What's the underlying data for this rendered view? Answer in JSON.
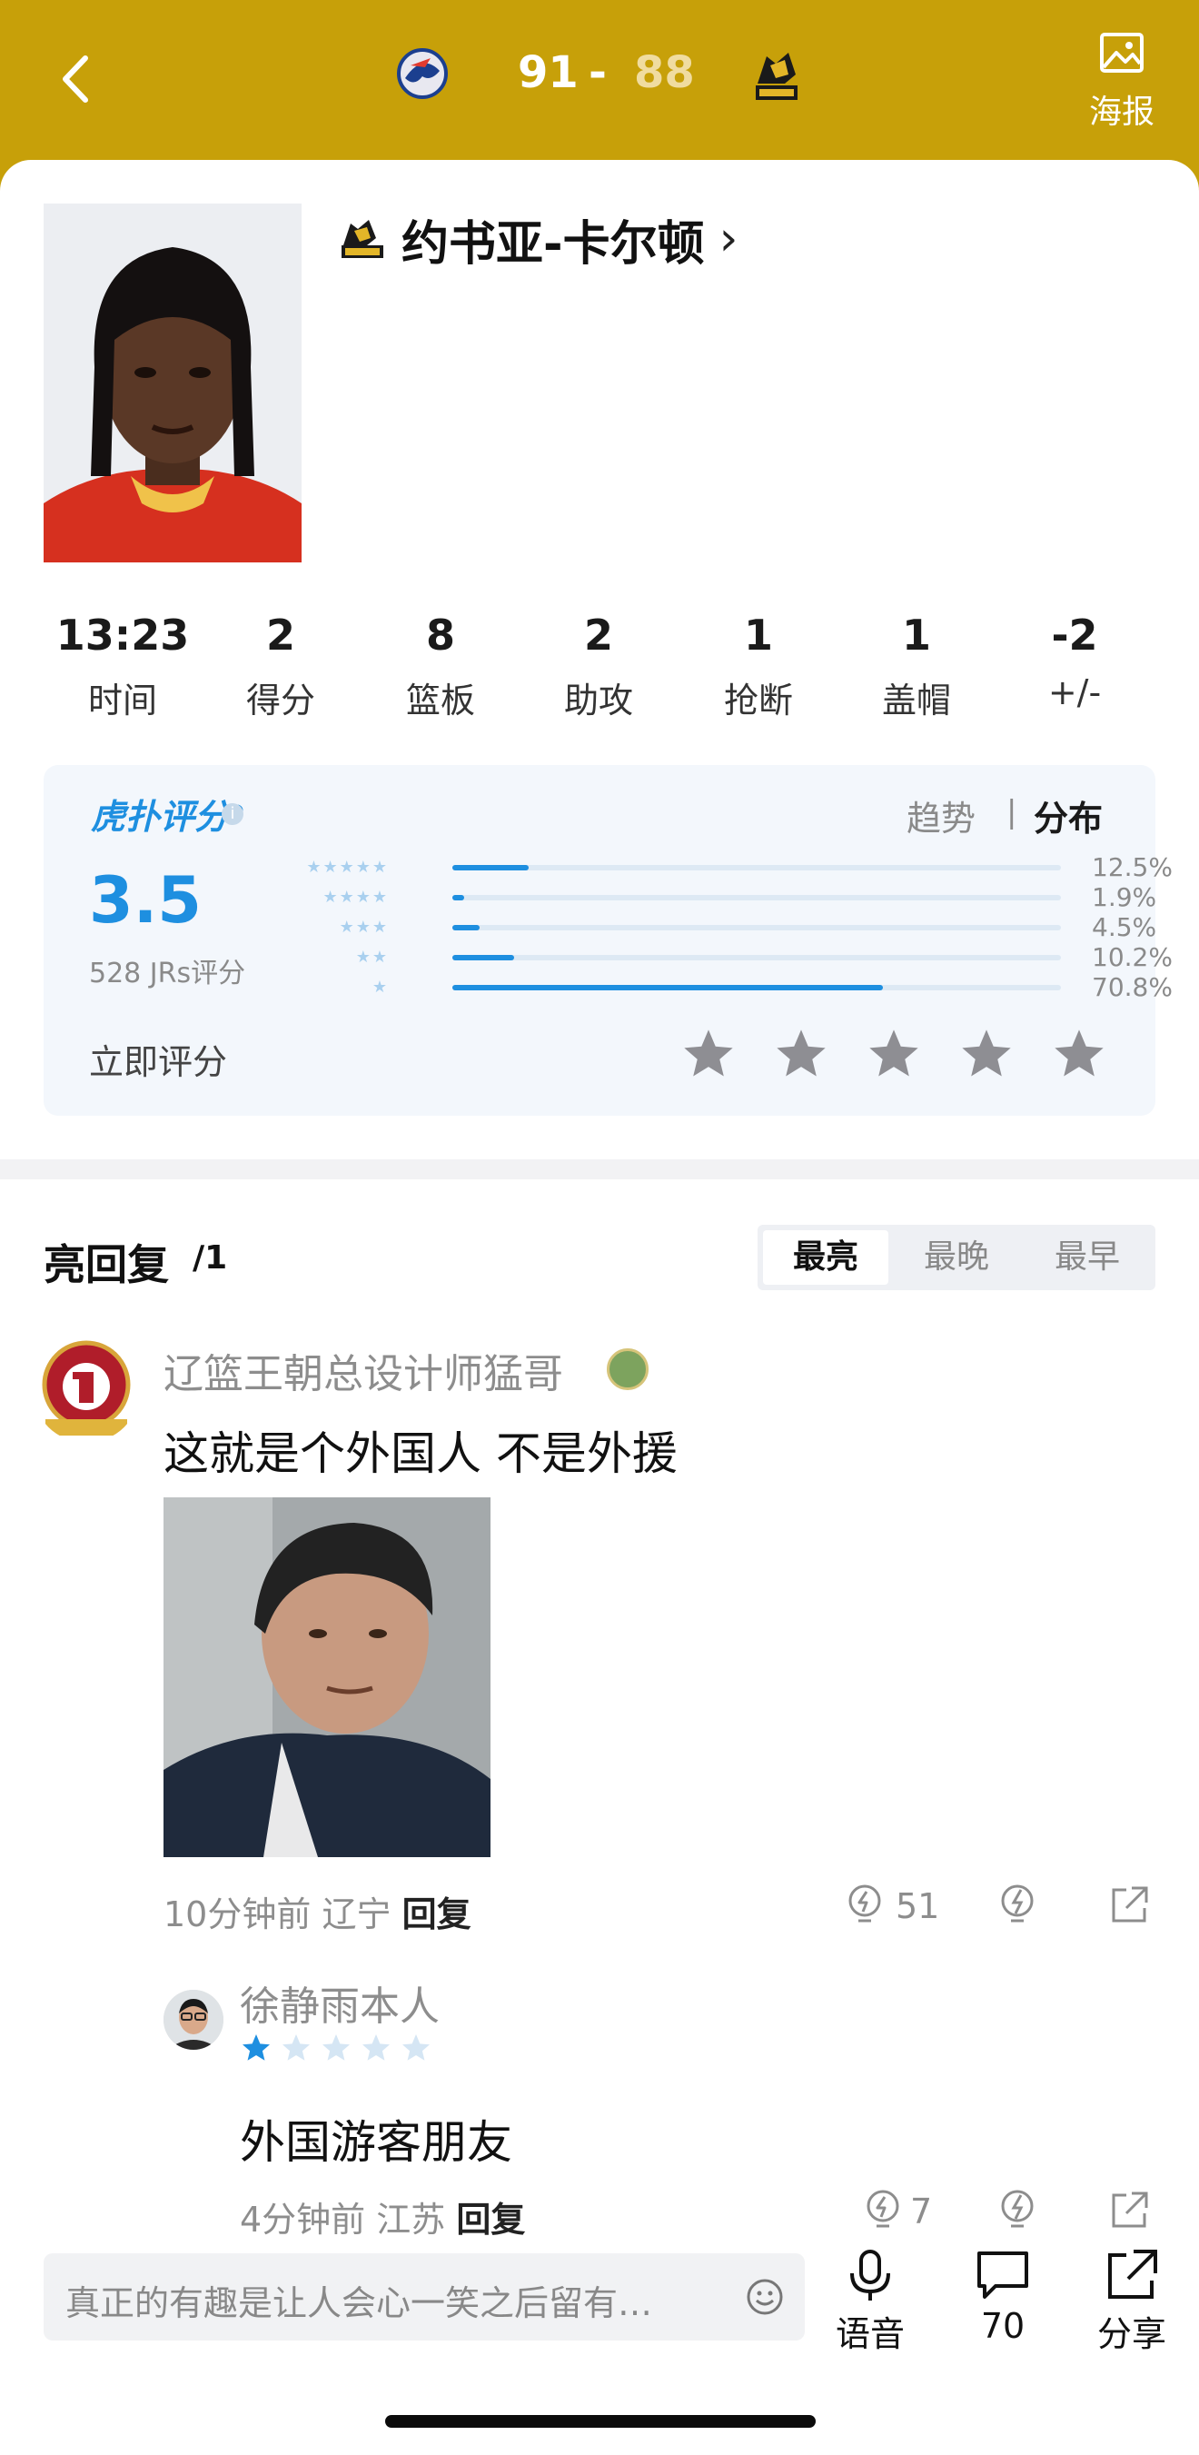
{
  "header": {
    "home_score": "91",
    "separator": "-",
    "away_score": "88",
    "poster_label": "海报",
    "colors": {
      "bar": "#c7a009",
      "away_score": "#f0dca0"
    }
  },
  "player": {
    "name": "约书亚-卡尔顿",
    "chevron": "›"
  },
  "stats": [
    {
      "value": "13:23",
      "label": "时间"
    },
    {
      "value": "2",
      "label": "得分"
    },
    {
      "value": "8",
      "label": "篮板"
    },
    {
      "value": "2",
      "label": "助攻"
    },
    {
      "value": "1",
      "label": "抢断"
    },
    {
      "value": "1",
      "label": "盖帽"
    },
    {
      "value": "-2",
      "label": "+/-"
    }
  ],
  "rating": {
    "brand": "虎扑评分",
    "brand_mark": "®",
    "info_icon": "i",
    "tab_trend": "趋势",
    "tab_sep": "|",
    "tab_dist": "分布",
    "score": "3.5",
    "count_text": "528 JRs评分",
    "rows": [
      {
        "stars": "★★★★★",
        "pct_text": "12.5%",
        "fraction": 0.125
      },
      {
        "stars": "★★★★",
        "pct_text": "1.9%",
        "fraction": 0.019
      },
      {
        "stars": "★★★",
        "pct_text": "4.5%",
        "fraction": 0.045
      },
      {
        "stars": "★★",
        "pct_text": "10.2%",
        "fraction": 0.102
      },
      {
        "stars": "★",
        "pct_text": "70.8%",
        "fraction": 0.708
      }
    ],
    "rate_now": "立即评分",
    "rate_star_count": 5
  },
  "replies": {
    "title": "亮回复",
    "count": "/1",
    "tabs": [
      "最亮",
      "最晚",
      "最早"
    ],
    "active_tab": "最亮"
  },
  "comment": {
    "user": "辽篮王朝总设计师猛哥",
    "text": "这就是个外国人  不是外援",
    "time": "10分钟前",
    "location": "辽宁",
    "reply_label": "回复",
    "likes": "51"
  },
  "subreply": {
    "user": "徐静雨本人",
    "star_rating": 1,
    "text": "外国游客朋友",
    "time": "4分钟前",
    "location": "江苏",
    "reply_label": "回复",
    "likes": "7"
  },
  "bottom": {
    "placeholder": "真正的有趣是让人会心一笑之后留有…",
    "voice_label": "语音",
    "comment_count": "70",
    "share_label": "分享"
  }
}
